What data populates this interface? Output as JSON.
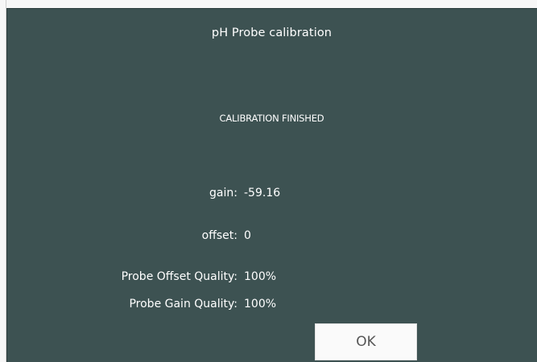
{
  "dialog": {
    "title": "pH Probe calibration",
    "status": "CALIBRATION FINISHED",
    "results": [
      {
        "label": "gain:",
        "value": "-59.16"
      },
      {
        "label": "offset:",
        "value": "0"
      },
      {
        "label": "Probe Offset Quality:",
        "value": "100%"
      },
      {
        "label": "Probe Gain Quality:",
        "value": "100%"
      }
    ],
    "ok_label": "OK"
  },
  "colors": {
    "dialog_background": "#3d5252",
    "text": "#ffffff",
    "button_background": "#fafafa",
    "button_text": "#555555"
  }
}
